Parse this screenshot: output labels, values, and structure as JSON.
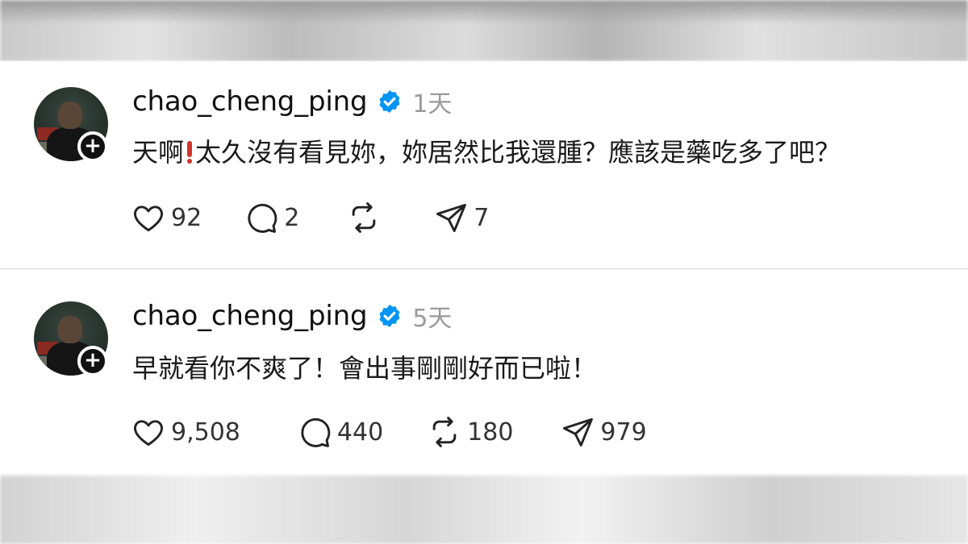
{
  "posts": [
    {
      "username": "chao_cheng_ping",
      "time": "1天",
      "text_before": "天啊",
      "text_after": "太久沒有看見妳，妳居然比我還腫？應該是藥吃多了吧？",
      "likes": "92",
      "replies": "2",
      "reposts": "",
      "shares": "7"
    },
    {
      "username": "chao_cheng_ping",
      "time": "5天",
      "text_before": "早就看你不爽了！會出事剛剛好而已啦！",
      "text_after": "",
      "likes": "9,508",
      "replies": "440",
      "reposts": "180",
      "shares": "979"
    }
  ],
  "icons": {
    "like": "heart-icon",
    "reply": "comment-icon",
    "repost": "repost-icon",
    "share": "send-icon",
    "verified": "verified-badge-icon",
    "follow": "plus-icon"
  },
  "colors": {
    "verified": "#0095f6",
    "exclamation": "#d0342c",
    "text": "#101010",
    "muted": "#9a9a9a"
  }
}
